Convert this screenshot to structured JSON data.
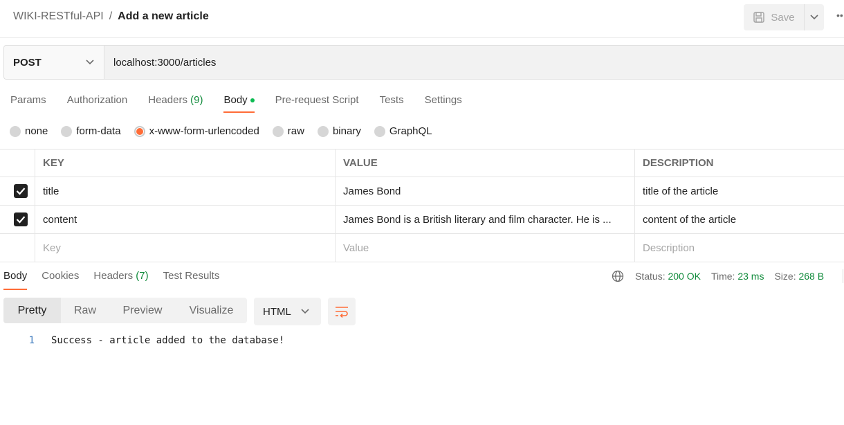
{
  "header": {
    "collection": "WIKI-RESTful-API",
    "separator": "/",
    "request_name": "Add a new article",
    "save_label": "Save"
  },
  "request": {
    "method": "POST",
    "url": "localhost:3000/articles"
  },
  "request_tabs": {
    "params": "Params",
    "authorization": "Authorization",
    "headers": "Headers",
    "headers_count": "(9)",
    "body": "Body",
    "pre_request": "Pre-request Script",
    "tests": "Tests",
    "settings": "Settings"
  },
  "body_types": {
    "none": "none",
    "form_data": "form-data",
    "urlencoded": "x-www-form-urlencoded",
    "raw": "raw",
    "binary": "binary",
    "graphql": "GraphQL",
    "selected": "x-www-form-urlencoded"
  },
  "params_table": {
    "headers": {
      "key": "KEY",
      "value": "VALUE",
      "description": "DESCRIPTION"
    },
    "rows": [
      {
        "key": "title",
        "value": "James Bond",
        "description": "title of the article",
        "checked": true
      },
      {
        "key": "content",
        "value": "James Bond is a British literary and film character. He is ...",
        "description": "content of the article",
        "checked": true
      }
    ],
    "placeholders": {
      "key": "Key",
      "value": "Value",
      "description": "Description"
    }
  },
  "response": {
    "tabs": {
      "body": "Body",
      "cookies": "Cookies",
      "headers": "Headers",
      "headers_count": "(7)",
      "test_results": "Test Results"
    },
    "status_label": "Status:",
    "status_value": "200 OK",
    "time_label": "Time:",
    "time_value": "23 ms",
    "size_label": "Size:",
    "size_value": "268 B",
    "view_tabs": {
      "pretty": "Pretty",
      "raw": "Raw",
      "preview": "Preview",
      "visualize": "Visualize"
    },
    "format": "HTML",
    "line_number": "1",
    "body_text": "Success - article added to the database!"
  },
  "colors": {
    "accent": "#ff6c37",
    "success": "#0f8a3a"
  }
}
